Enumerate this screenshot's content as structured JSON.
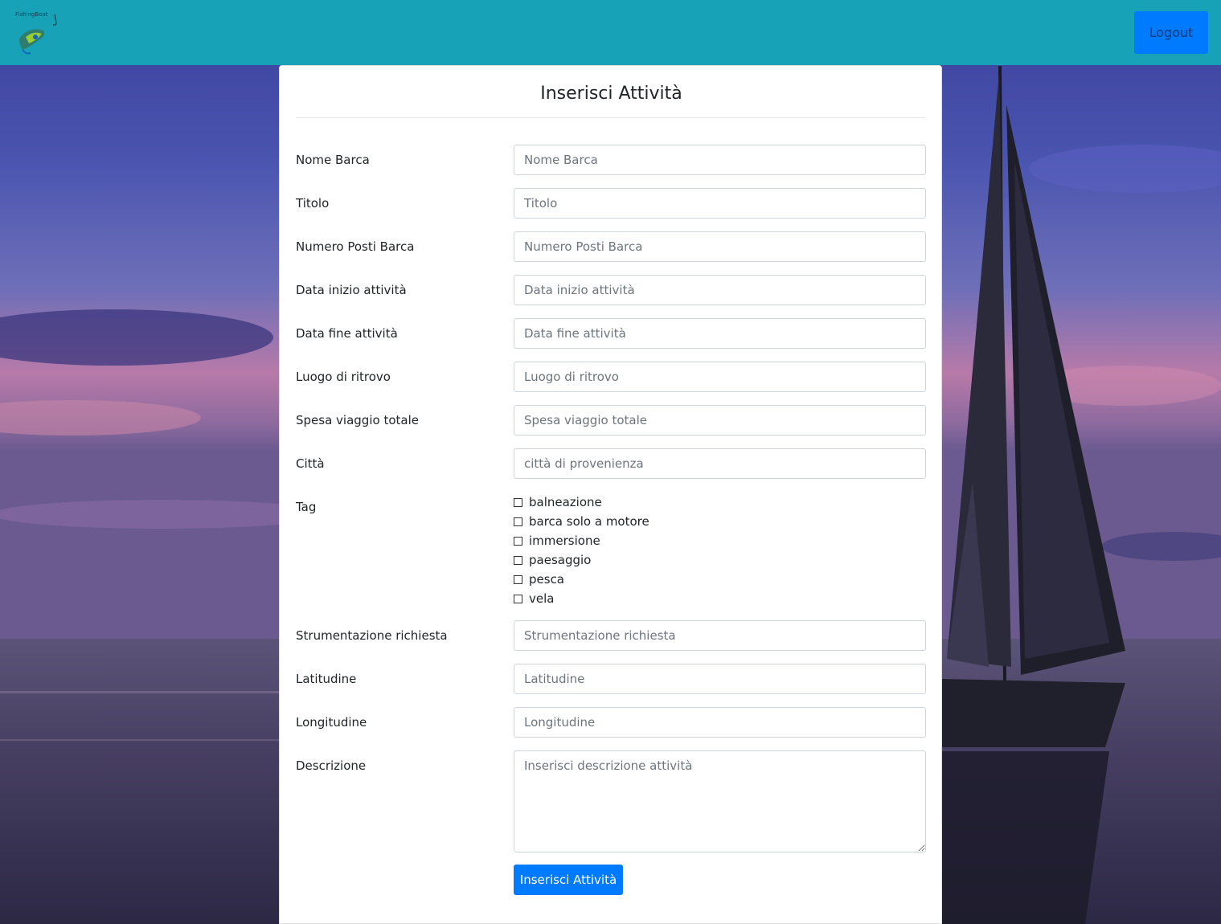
{
  "navbar": {
    "logo_text": "FishingBoat",
    "logout_label": "Logout"
  },
  "form": {
    "title": "Inserisci Attività",
    "fields": [
      {
        "label": "Nome Barca",
        "placeholder": "Nome Barca",
        "value": ""
      },
      {
        "label": "Titolo",
        "placeholder": "Titolo",
        "value": ""
      },
      {
        "label": "Numero Posti Barca",
        "placeholder": "Numero Posti Barca",
        "value": ""
      },
      {
        "label": "Data inizio attività",
        "placeholder": "Data inizio attività",
        "value": ""
      },
      {
        "label": "Data fine attività",
        "placeholder": "Data fine attività",
        "value": ""
      },
      {
        "label": "Luogo di ritrovo",
        "placeholder": "Luogo di ritrovo",
        "value": ""
      },
      {
        "label": "Spesa viaggio totale",
        "placeholder": "Spesa viaggio totale",
        "value": ""
      },
      {
        "label": "Città",
        "placeholder": "città di provenienza",
        "value": ""
      }
    ],
    "tag_label": "Tag",
    "tags": [
      {
        "label": "balneazione",
        "checked": false
      },
      {
        "label": "barca solo a motore",
        "checked": false
      },
      {
        "label": "immersione",
        "checked": false
      },
      {
        "label": "paesaggio",
        "checked": false
      },
      {
        "label": "pesca",
        "checked": false
      },
      {
        "label": "vela",
        "checked": false
      }
    ],
    "fields2": [
      {
        "label": "Strumentazione richiesta",
        "placeholder": "Strumentazione richiesta",
        "value": ""
      },
      {
        "label": "Latitudine",
        "placeholder": "Latitudine",
        "value": ""
      },
      {
        "label": "Longitudine",
        "placeholder": "Longitudine",
        "value": ""
      }
    ],
    "description": {
      "label": "Descrizione",
      "placeholder": "Inserisci descrizione attività",
      "value": ""
    },
    "submit_label": "Inserisci Attività"
  },
  "colors": {
    "navbar": "#17a2b8",
    "primary": "#007bff"
  }
}
